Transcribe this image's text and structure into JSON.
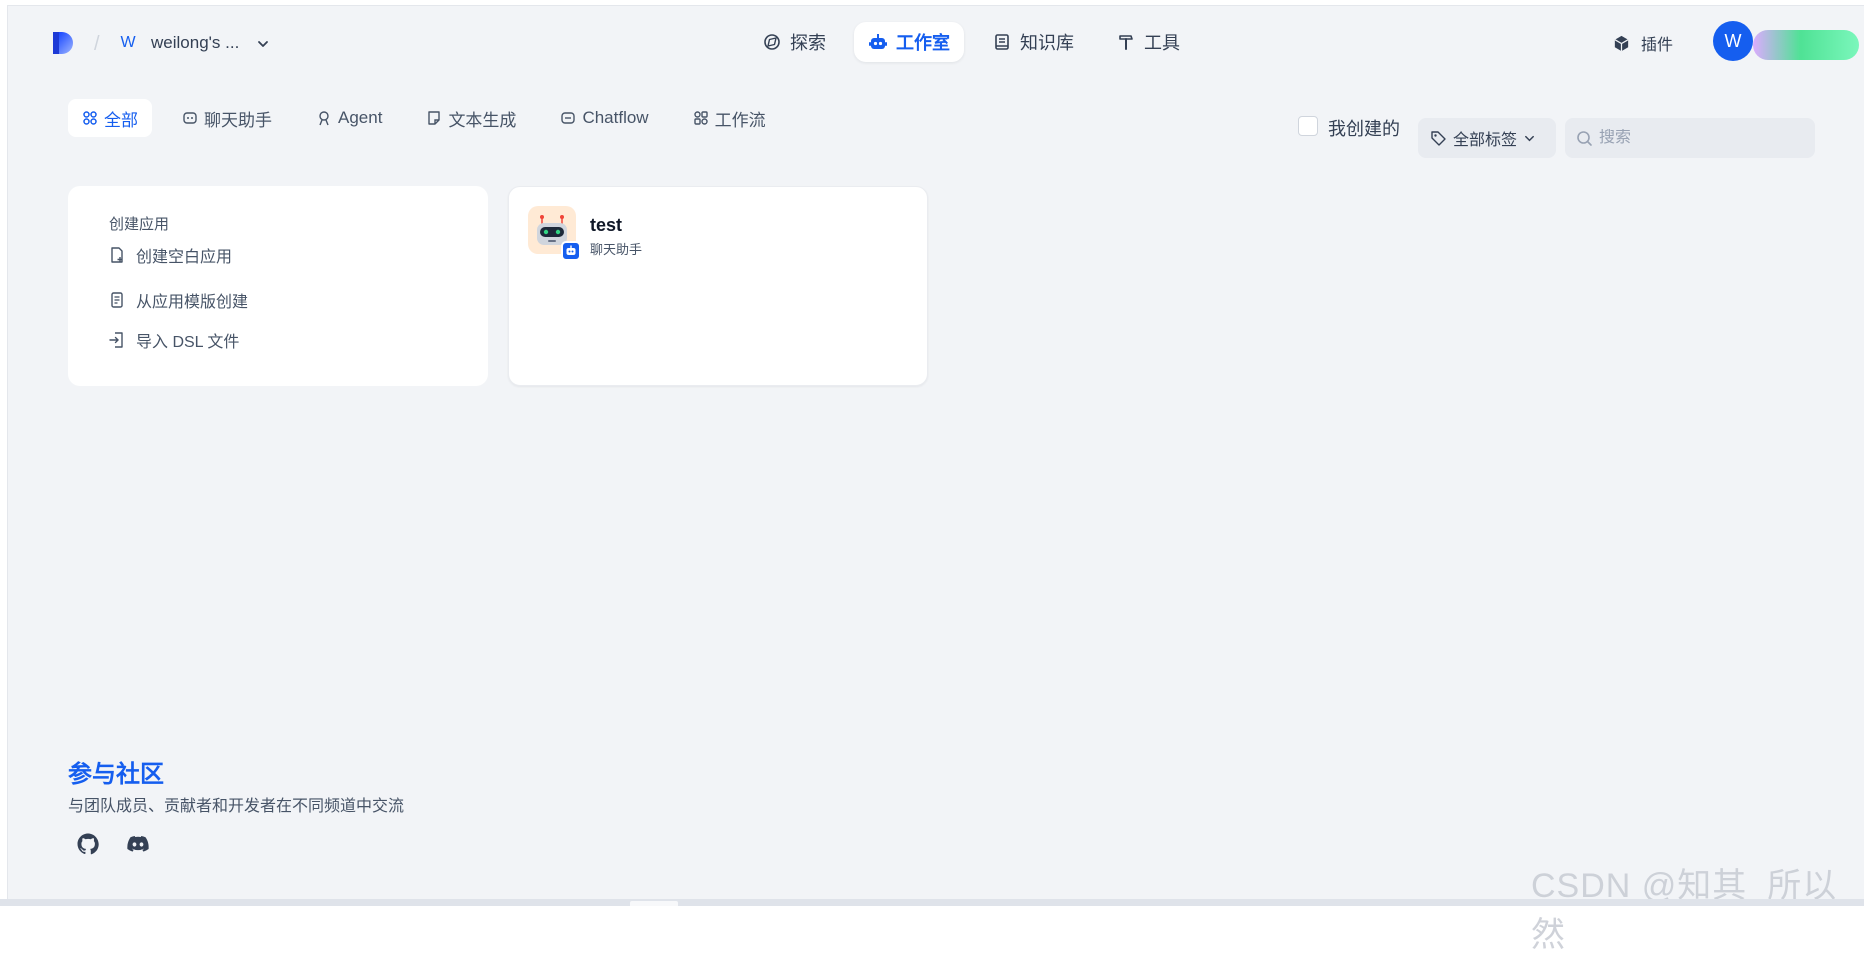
{
  "header": {
    "workspace_initial": "W",
    "workspace_name": "weilong's ...",
    "nav": [
      {
        "label": "探索",
        "icon": "compass-icon"
      },
      {
        "label": "工作室",
        "icon": "robot-icon",
        "active": true
      },
      {
        "label": "知识库",
        "icon": "book-icon"
      },
      {
        "label": "工具",
        "icon": "hammer-icon"
      }
    ],
    "plugin_label": "插件",
    "user_initial": "W"
  },
  "filters": {
    "tabs": [
      {
        "label": "全部",
        "icon": "grid-icon",
        "active": true
      },
      {
        "label": "聊天助手",
        "icon": "chat-icon"
      },
      {
        "label": "Agent",
        "icon": "agent-icon"
      },
      {
        "label": "文本生成",
        "icon": "document-icon"
      },
      {
        "label": "Chatflow",
        "icon": "chatflow-icon"
      },
      {
        "label": "工作流",
        "icon": "workflow-icon"
      }
    ],
    "created_by_me": "我创建的",
    "tag_filter": "全部标签",
    "search_placeholder": "搜索"
  },
  "create_card": {
    "title": "创建应用",
    "items": [
      {
        "label": "创建空白应用",
        "icon": "file-plus-icon"
      },
      {
        "label": "从应用模版创建",
        "icon": "template-icon"
      },
      {
        "label": "导入 DSL 文件",
        "icon": "import-icon"
      }
    ]
  },
  "apps": [
    {
      "name": "test",
      "type": "聊天助手",
      "icon": "robot-avatar-icon"
    }
  ],
  "community": {
    "title": "参与社区",
    "description": "与团队成员、贡献者和开发者在不同频道中交流"
  },
  "watermark": "CSDN @知其_所以然",
  "colors": {
    "accent": "#155eef",
    "background": "#f2f4f7",
    "card": "#ffffff"
  }
}
